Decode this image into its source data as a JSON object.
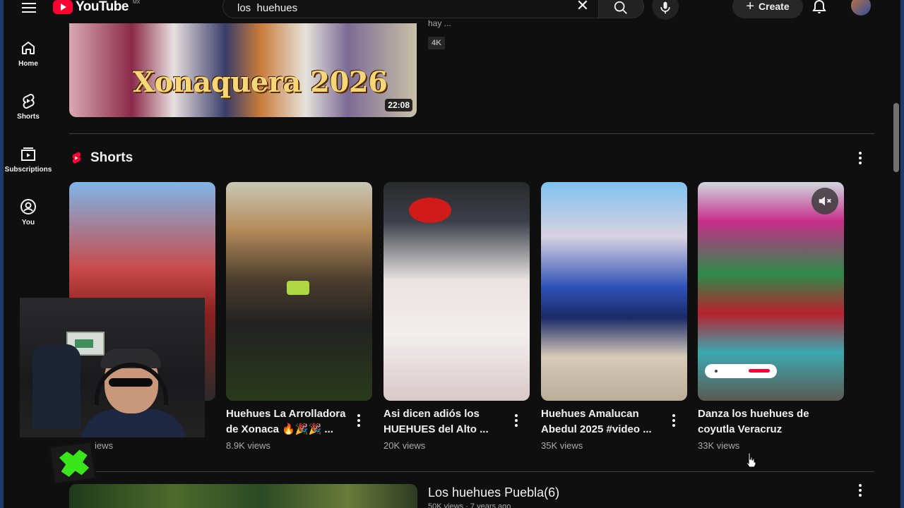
{
  "header": {
    "brand": "YouTube",
    "brand_region": "MX",
    "search_value": "los  huehues",
    "create_label": "Create"
  },
  "sidebar": {
    "items": [
      {
        "label": "Home",
        "icon": "home-icon"
      },
      {
        "label": "Shorts",
        "icon": "shorts-icon"
      },
      {
        "label": "Subscriptions",
        "icon": "subscriptions-icon"
      },
      {
        "label": "You",
        "icon": "you-icon"
      }
    ]
  },
  "top_video": {
    "thumb_text": "Xonaquera 2026",
    "duration": "22:08",
    "snippet": "hay ...",
    "badge": "4K"
  },
  "shorts_shelf": {
    "title": "Shorts",
    "items": [
      {
        "title": "",
        "views": "iews"
      },
      {
        "title": "Huehues La Arrolladora de Xonaca 🔥🎉🎉 ...",
        "views": "8.9K views"
      },
      {
        "title": "Asi dicen adiós los HUEHUES del Alto ...",
        "views": "20K views"
      },
      {
        "title": "Huehues Amalucan Abedul 2025 #video ...",
        "views": "35K views"
      },
      {
        "title": "Danza los huehues de coyutla Veracruz",
        "views": "33K views"
      }
    ]
  },
  "bottom_video": {
    "title": "Los huehues Puebla(6)",
    "meta": "50K views · 7 years ago"
  },
  "colors": {
    "background": "#0f0f0f",
    "brand_red": "#ff0033",
    "text_primary": "#f1f1f1",
    "text_secondary": "#aaaaaa"
  }
}
